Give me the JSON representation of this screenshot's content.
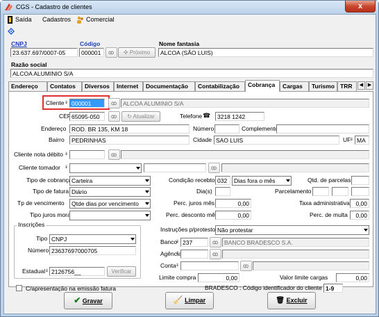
{
  "window": {
    "title": "CGS - Cadastro de clientes",
    "close": "x"
  },
  "menu": {
    "saida": "Saída",
    "cadastros": "Cadastros",
    "comercial": "Comercial"
  },
  "header": {
    "cnpj_label": "CNPJ",
    "cnpj_value": "23.637.697/0007-05",
    "codigo_label": "Código",
    "codigo_value": "000001",
    "proximo_label": "Próximo",
    "fantasia_label": "Nome fantasia",
    "fantasia_value": "ALCOA (SÃO LUIS)",
    "razao_label": "Razão social",
    "razao_value": "ALCOA ALUMINIO S/A"
  },
  "tabs": [
    "Endereço",
    "Contatos",
    "Diversos",
    "Internet",
    "Documentação",
    "Contabilização",
    "Cobrança",
    "Cargas",
    "Turismo",
    "TRR"
  ],
  "active_tab": "Cobrança",
  "form": {
    "cliente_label": "Cliente",
    "cliente_code": "000001",
    "cliente_name": "ALCOA ALUMINIO S/A",
    "cep_label": "CEP",
    "cep_value": "65095-050",
    "atualizar_label": "Atualizar",
    "telefone_label": "Telefone",
    "telefone_value": "3218 1242",
    "endereco_label": "Endereço",
    "endereco_value": "ROD. BR 135, KM 18",
    "numero_label": "Número",
    "complemento_label": "Complemento",
    "bairro_label": "Bairro",
    "bairro_value": "PEDRINHAS",
    "cidade_label": "Cidade",
    "cidade_value": "SAO LUIS",
    "uf_label": "UF",
    "uf_value": "MA",
    "nota_debito_label": "Cliente nota débito",
    "tomador_label": "Cliente tomador",
    "tipo_cobranca_label": "Tipo de cobrança",
    "tipo_cobranca_value": "Carteira",
    "cond_label": "Condição recebto",
    "cond_code": "032",
    "cond_value": "Dias fora o mês",
    "qtd_parcelas_label": "Qtd. de parcelas",
    "tipo_fatura_label": "Tipo de fatura",
    "tipo_fatura_value": "Diário",
    "dias_label": "Dia(s)",
    "parcelamento_label": "Parcelamento",
    "tp_venc_label": "Tp de vencimento",
    "tp_venc_value": "Qtde dias por vencimento",
    "perc_juros_label": "Perc. juros mês",
    "perc_juros_value": "0,00",
    "taxa_adm_label": "Taxa administrativa",
    "taxa_adm_value": "0,00",
    "tipo_juros_label": "Tipo juros mora",
    "perc_desc_label": "Perc. desconto mês",
    "perc_desc_value": "0,00",
    "perc_multa_label": "Perc. de multa",
    "perc_multa_value": "0,00",
    "inscricoes_label": "Inscrições",
    "tipo_label": "Tipo",
    "tipo_value": "CNPJ",
    "numero_insc_label": "Número",
    "numero_insc_value": "23637697000705",
    "estadual_label": "Estadual",
    "estadual_value": "2126756__",
    "verificar_label": "Verificar",
    "instrucoes_label": "Instruções p/protesto",
    "instrucoes_value": "Não protestar",
    "banco_label": "Banco",
    "banco_code": "237",
    "banco_name": "BANCO BRADESCO S.A.",
    "agencia_label": "Agência",
    "conta_label": "Conta",
    "limite_compra_label": "Limite compra",
    "limite_compra_value": "0,00",
    "valor_limite_label": "Valor limite cargas",
    "valor_limite_value": "0,00",
    "bradesco_label": "BRADESCO : Código identificador do cliente",
    "bradesco_value": "1-9",
    "apresentacao_label": "C/apresentação na emissão fatura"
  },
  "buttons": {
    "gravar": "Gravar",
    "limpar": "Limpar",
    "excluir": "Excluir"
  }
}
